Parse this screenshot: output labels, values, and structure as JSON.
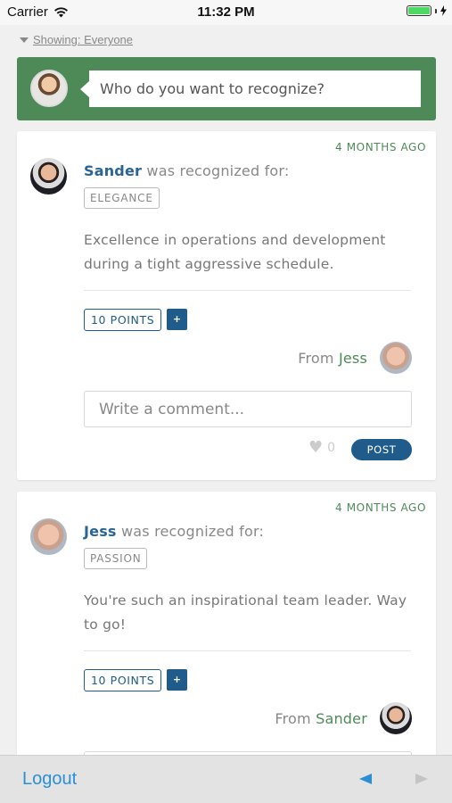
{
  "status_bar": {
    "carrier": "Carrier",
    "time": "11:32 PM",
    "battery_level": 1.0,
    "icons": [
      "wifi-icon",
      "battery-icon",
      "charging-icon"
    ]
  },
  "filter": {
    "label": "Showing: Everyone"
  },
  "recognize": {
    "placeholder": "Who do you want to recognize?"
  },
  "feed": [
    {
      "time_ago": "4 MONTHS AGO",
      "recipient": "Sander",
      "recognized_text": "was recognized for:",
      "tag": "ELEGANCE",
      "message": "Excellence in operations and development during a tight aggressive schedule.",
      "points": "10 POINTS",
      "plus": "+",
      "from_prefix": "From",
      "from_name": "Jess",
      "comment_placeholder": "Write a comment...",
      "likes": "0",
      "post_label": "POST"
    },
    {
      "time_ago": "4 MONTHS AGO",
      "recipient": "Jess",
      "recognized_text": "was recognized for:",
      "tag": "PASSION",
      "message": "You're such an inspirational team leader. Way to go!",
      "points": "10 POINTS",
      "plus": "+",
      "from_prefix": "From",
      "from_name": "Sander"
    }
  ],
  "bottom_bar": {
    "logout": "Logout"
  },
  "colors": {
    "brand_green": "#4e8a57",
    "accent_blue": "#1f5c8b",
    "link_blue": "#2a8fd4"
  }
}
